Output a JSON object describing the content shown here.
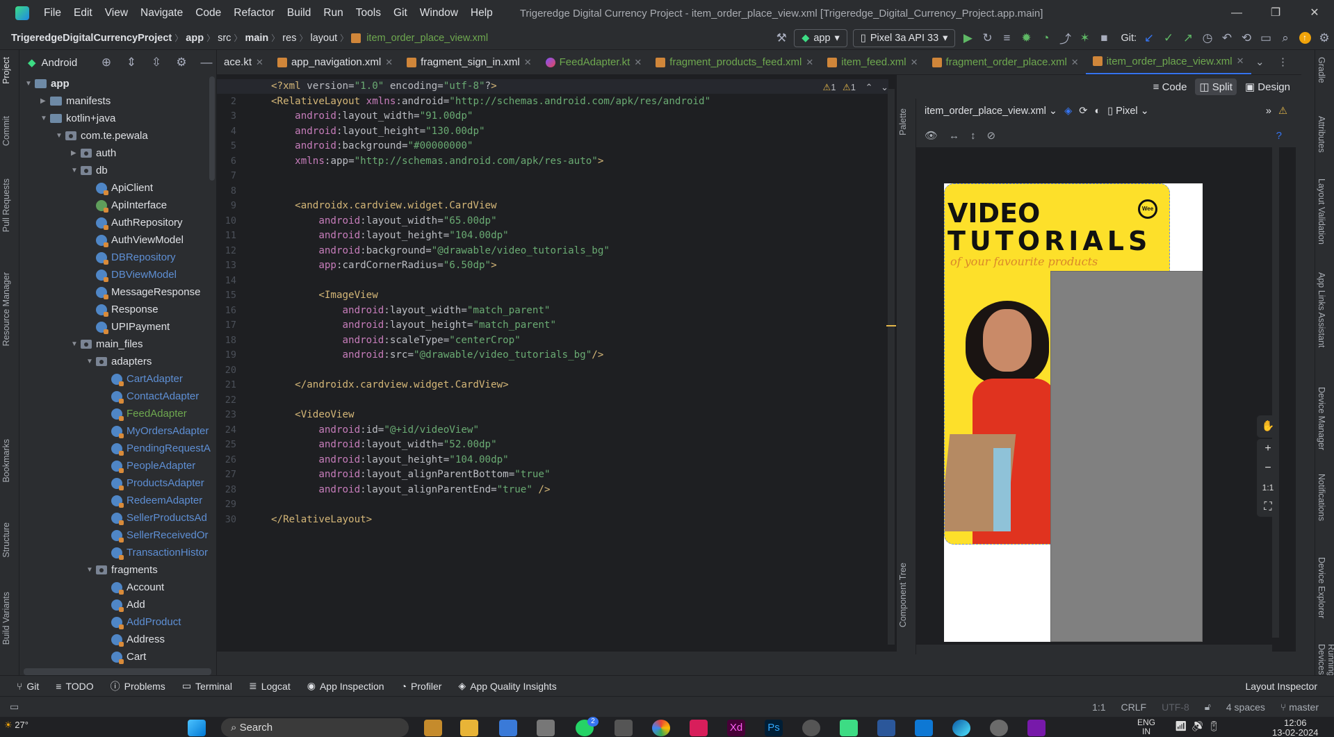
{
  "menu": [
    "File",
    "Edit",
    "View",
    "Navigate",
    "Code",
    "Refactor",
    "Build",
    "Run",
    "Tools",
    "Git",
    "Window",
    "Help"
  ],
  "window_title": "Trigeredge Digital Currency Project - item_order_place_view.xml [Trigeredge_Digital_Currency_Project.app.main]",
  "breadcrumb": {
    "project": "TrigeredgeDigitalCurrencyProject",
    "c1": "app",
    "c2": "src",
    "c3": "main",
    "c4": "res",
    "c5": "layout",
    "file": "item_order_place_view.xml"
  },
  "run_config": "app",
  "device": "Pixel 3a API 33",
  "git_label": "Git:",
  "project_view": "Android",
  "tree": [
    {
      "label": "app",
      "indent": 0,
      "type": "folder",
      "open": true,
      "bold": true
    },
    {
      "label": "manifests",
      "indent": 1,
      "type": "folder",
      "open": false
    },
    {
      "label": "kotlin+java",
      "indent": 1,
      "type": "folder",
      "open": true
    },
    {
      "label": "com.te.pewala",
      "indent": 2,
      "type": "pkg",
      "open": true
    },
    {
      "label": "auth",
      "indent": 3,
      "type": "pkg",
      "open": false
    },
    {
      "label": "db",
      "indent": 3,
      "type": "pkg",
      "open": true
    },
    {
      "label": "ApiClient",
      "indent": 4,
      "type": "cls"
    },
    {
      "label": "ApiInterface",
      "indent": 4,
      "type": "clsg"
    },
    {
      "label": "AuthRepository",
      "indent": 4,
      "type": "cls"
    },
    {
      "label": "AuthViewModel",
      "indent": 4,
      "type": "cls"
    },
    {
      "label": "DBRepository",
      "indent": 4,
      "type": "cls",
      "dim": true
    },
    {
      "label": "DBViewModel",
      "indent": 4,
      "type": "cls",
      "dim": true
    },
    {
      "label": "MessageResponse",
      "indent": 4,
      "type": "cls"
    },
    {
      "label": "Response",
      "indent": 4,
      "type": "cls"
    },
    {
      "label": "UPIPayment",
      "indent": 4,
      "type": "cls"
    },
    {
      "label": "main_files",
      "indent": 3,
      "type": "pkg",
      "open": true
    },
    {
      "label": "adapters",
      "indent": 4,
      "type": "pkg",
      "open": true
    },
    {
      "label": "CartAdapter",
      "indent": 5,
      "type": "cls",
      "dim": true
    },
    {
      "label": "ContactAdapter",
      "indent": 5,
      "type": "cls",
      "dim": true
    },
    {
      "label": "FeedAdapter",
      "indent": 5,
      "type": "cls",
      "green": true
    },
    {
      "label": "MyOrdersAdapter",
      "indent": 5,
      "type": "cls",
      "dim": true
    },
    {
      "label": "PendingRequestA",
      "indent": 5,
      "type": "cls",
      "dim": true
    },
    {
      "label": "PeopleAdapter",
      "indent": 5,
      "type": "cls",
      "dim": true
    },
    {
      "label": "ProductsAdapter",
      "indent": 5,
      "type": "cls",
      "dim": true
    },
    {
      "label": "RedeemAdapter",
      "indent": 5,
      "type": "cls",
      "dim": true
    },
    {
      "label": "SellerProductsAd",
      "indent": 5,
      "type": "cls",
      "dim": true
    },
    {
      "label": "SellerReceivedOr",
      "indent": 5,
      "type": "cls",
      "dim": true
    },
    {
      "label": "TransactionHistor",
      "indent": 5,
      "type": "cls",
      "dim": true
    },
    {
      "label": "fragments",
      "indent": 4,
      "type": "pkg",
      "open": true
    },
    {
      "label": "Account",
      "indent": 5,
      "type": "cls"
    },
    {
      "label": "Add",
      "indent": 5,
      "type": "cls"
    },
    {
      "label": "AddProduct",
      "indent": 5,
      "type": "cls",
      "dim": true
    },
    {
      "label": "Address",
      "indent": 5,
      "type": "cls"
    },
    {
      "label": "Cart",
      "indent": 5,
      "type": "cls"
    }
  ],
  "tabs": [
    {
      "label": "ace.kt",
      "kind": "kt",
      "active": false
    },
    {
      "label": "app_navigation.xml",
      "kind": "xml",
      "active": false
    },
    {
      "label": "fragment_sign_in.xml",
      "kind": "xml",
      "active": false
    },
    {
      "label": "FeedAdapter.kt",
      "kind": "kt",
      "active": false,
      "green": true
    },
    {
      "label": "fragment_products_feed.xml",
      "kind": "xml",
      "active": false,
      "green": true
    },
    {
      "label": "item_feed.xml",
      "kind": "xml",
      "active": false,
      "green": true
    },
    {
      "label": "fragment_order_place.xml",
      "kind": "xml",
      "active": false,
      "green": true
    },
    {
      "label": "item_order_place_view.xml",
      "kind": "xml",
      "active": true,
      "green": true
    }
  ],
  "code_lines": [
    "<?xml version=\"1.0\" encoding=\"utf-8\"?>",
    "<RelativeLayout xmlns:android=\"http://schemas.android.com/apk/res/android\"",
    "    android:layout_width=\"91.00dp\"",
    "    android:layout_height=\"130.00dp\"",
    "    android:background=\"#00000000\"",
    "    xmlns:app=\"http://schemas.android.com/apk/res-auto\">",
    "",
    "",
    "    <androidx.cardview.widget.CardView",
    "        android:layout_width=\"65.00dp\"",
    "        android:layout_height=\"104.00dp\"",
    "        android:background=\"@drawable/video_tutorials_bg\"",
    "        app:cardCornerRadius=\"6.50dp\">",
    "",
    "        <ImageView",
    "            android:layout_width=\"match_parent\"",
    "            android:layout_height=\"match_parent\"",
    "            android:scaleType=\"centerCrop\"",
    "            android:src=\"@drawable/video_tutorials_bg\"/>",
    "",
    "    </androidx.cardview.widget.CardView>",
    "",
    "    <VideoView",
    "        android:id=\"@+id/videoView\"",
    "        android:layout_width=\"52.00dp\"",
    "        android:layout_height=\"104.00dp\"",
    "        android:layout_alignParentBottom=\"true\"",
    "        android:layout_alignParentEnd=\"true\" />",
    "",
    "</RelativeLayout>"
  ],
  "warnings": {
    "w1": "1",
    "w2": "1"
  },
  "view_modes": {
    "code": "Code",
    "split": "Split",
    "design": "Design"
  },
  "design_toolbar": {
    "file": "item_order_place_view.xml",
    "device": "Pixel"
  },
  "palette_label": "Palette",
  "component_tree_label": "Component Tree",
  "preview": {
    "line1": "VIDEO",
    "line2": "TUTORIALS",
    "tagline": "of your favourite products",
    "logo": "Wee"
  },
  "zoom": {
    "plus": "+",
    "minus": "−",
    "fit": "1:1"
  },
  "left_tabs": [
    "Project",
    "Commit",
    "Pull Requests",
    "Resource Manager",
    "Bookmarks",
    "Structure",
    "Build Variants"
  ],
  "right_tabs": [
    "Gradle",
    "Attributes",
    "Layout Validation",
    "App Links Assistant",
    "Device Manager",
    "Notifications",
    "Device Explorer",
    "Running Devices"
  ],
  "tool_windows": [
    "Git",
    "TODO",
    "Problems",
    "Terminal",
    "Logcat",
    "App Inspection",
    "Profiler",
    "App Quality Insights"
  ],
  "layout_inspector": "Layout Inspector",
  "status": {
    "pos": "1:1",
    "eol": "CRLF",
    "enc": "UTF-8",
    "indent": "4 spaces",
    "branch": "master"
  },
  "taskbar": {
    "weather": "27°",
    "search": "Search",
    "lang1": "ENG",
    "lang2": "IN",
    "time": "12:06",
    "date": "13-02-2024",
    "badge": "2"
  },
  "colors": {
    "accent": "#3574f0",
    "green_file": "#6ea84f",
    "yellow_bg": "#fde02a",
    "preview_red": "#e0331f"
  }
}
